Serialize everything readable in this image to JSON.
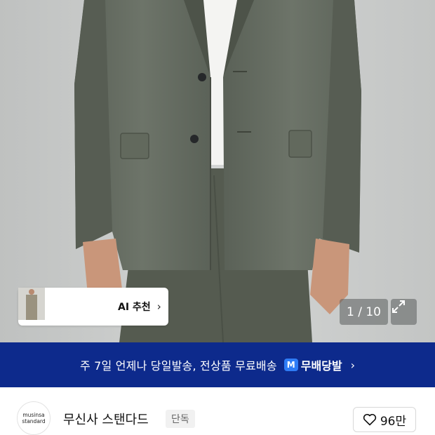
{
  "product_image": {
    "alt": "olive suit jacket and trousers"
  },
  "ai_recommend": {
    "label": "AI 추천",
    "chevron": "›",
    "thumbnails": [
      "thumb-suit-olive",
      "thumb-suit-dark",
      "thumb-suit-beige"
    ]
  },
  "gallery": {
    "counter": "1 / 10",
    "expand_icon": "expand-icon"
  },
  "delivery_banner": {
    "text": "주 7일 언제나 당일발송, 전상품 무료배송",
    "badge": "M",
    "service": "무배당발",
    "chevron": "›",
    "bg_color": "#0d2a8c",
    "badge_color": "#2e7cf6"
  },
  "brand": {
    "logo_line1": "musinsa",
    "logo_line2": "standard",
    "name": "무신사 스탠다드",
    "tag": "단독",
    "likes": "96만",
    "like_icon": "heart-icon"
  }
}
